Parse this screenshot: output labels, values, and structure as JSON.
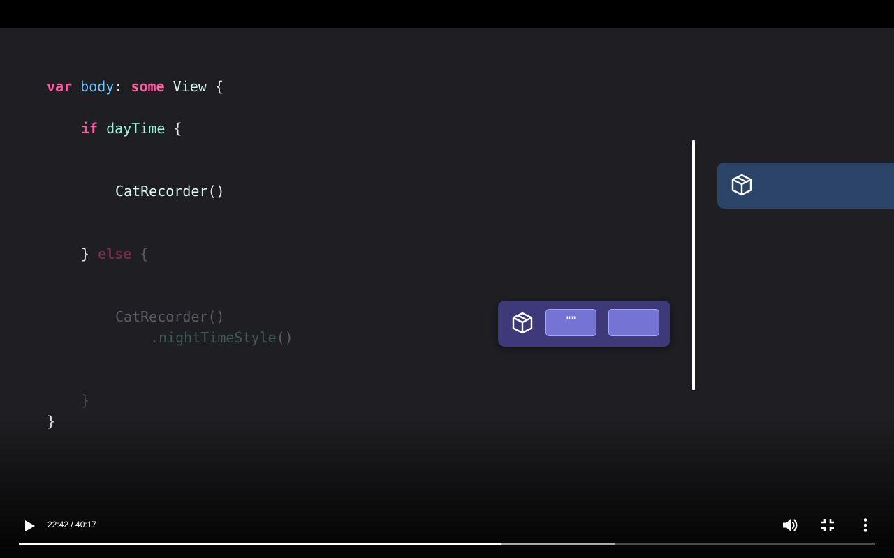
{
  "video": {
    "code_lines": [
      {
        "parts": [
          {
            "t": "var",
            "c": "kw"
          },
          {
            "t": " ",
            "c": "plain"
          },
          {
            "t": "body",
            "c": "ident-blue"
          },
          {
            "t": ": ",
            "c": "plain"
          },
          {
            "t": "some",
            "c": "kw"
          },
          {
            "t": " ",
            "c": "plain"
          },
          {
            "t": "View",
            "c": "type"
          },
          {
            "t": " {",
            "c": "plain"
          }
        ]
      },
      {
        "parts": [
          {
            "t": "if",
            "c": "kw"
          },
          {
            "t": " ",
            "c": "plain"
          },
          {
            "t": "dayTime",
            "c": "ident-green"
          },
          {
            "t": " {",
            "c": "plain"
          }
        ]
      },
      {
        "parts": [
          {
            "t": "CatRecorder",
            "c": "type"
          },
          {
            "t": "()",
            "c": "plain"
          }
        ]
      },
      {
        "parts": [
          {
            "t": "} ",
            "c": "plain"
          },
          {
            "t": "else",
            "c": "kw-dim"
          },
          {
            "t": " {",
            "c": "dim"
          }
        ]
      },
      {
        "parts": [
          {
            "t": "CatRecorder",
            "c": "dim"
          },
          {
            "t": "()",
            "c": "dim"
          }
        ]
      },
      {
        "parts": [
          {
            "t": ".nightTimeStyle",
            "c": "dim-green"
          },
          {
            "t": "()",
            "c": "dim"
          }
        ]
      },
      {
        "parts": [
          {
            "t": "}",
            "c": "dim-brace"
          }
        ]
      },
      {
        "parts": [
          {
            "t": "}",
            "c": "plain"
          }
        ]
      }
    ],
    "view_card": {
      "icon": "cube-icon",
      "slot_a_label": "\"\"",
      "slot_b_label": ""
    },
    "node_panel": {
      "icon": "cube-icon"
    }
  },
  "player": {
    "current_time": "22:42",
    "duration": "40:17",
    "time_display": "22:42 / 40:17",
    "played_fraction": 0.5627,
    "buffered_fraction": 0.696,
    "icons": {
      "play": "play-icon",
      "volume": "volume-icon",
      "exit_fullscreen": "exit-fullscreen-icon",
      "more": "more-options-icon"
    }
  }
}
